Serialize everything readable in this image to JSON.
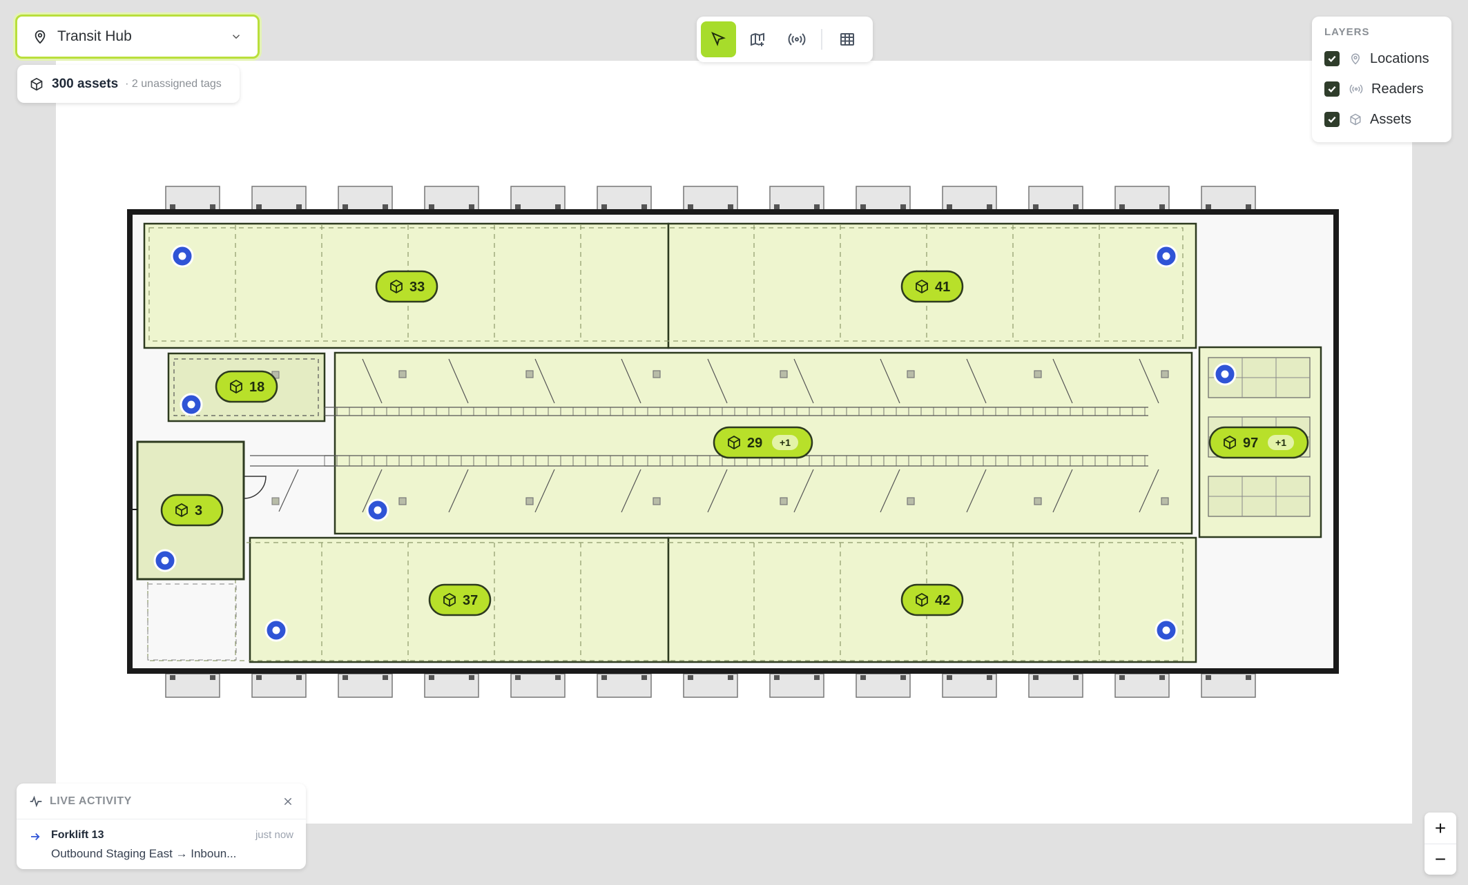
{
  "site_selector": {
    "value": "Transit Hub",
    "icon": "map-pin-icon"
  },
  "asset_summary": {
    "count": "300 assets",
    "unassigned": "· 2 unassigned tags"
  },
  "toolbar": {
    "tools": [
      "select-tool",
      "add-location-tool",
      "reader-tool",
      "grid-view-tool"
    ],
    "active": "select-tool"
  },
  "layers": {
    "title": "LAYERS",
    "items": [
      {
        "label": "Locations",
        "checked": true,
        "icon": "map-pin-icon"
      },
      {
        "label": "Readers",
        "checked": true,
        "icon": "broadcast-icon"
      },
      {
        "label": "Assets",
        "checked": true,
        "icon": "box-icon"
      }
    ]
  },
  "zones": [
    {
      "id": "zone-top-left",
      "count": "33",
      "extra": ""
    },
    {
      "id": "zone-top-right",
      "count": "41",
      "extra": ""
    },
    {
      "id": "zone-office",
      "count": "18",
      "extra": ""
    },
    {
      "id": "zone-middle",
      "count": "29",
      "extra": "+1"
    },
    {
      "id": "zone-east",
      "count": "97",
      "extra": "+1"
    },
    {
      "id": "zone-west",
      "count": "3",
      "extra": ""
    },
    {
      "id": "zone-bottom-left",
      "count": "37",
      "extra": ""
    },
    {
      "id": "zone-bottom-right",
      "count": "42",
      "extra": ""
    }
  ],
  "live_activity": {
    "title": "LIVE ACTIVITY",
    "items": [
      {
        "name": "Forklift 13",
        "route": "Outbound Staging East → Inboun...",
        "time": "just now"
      }
    ]
  },
  "zoom": {
    "in": "+",
    "out": "−"
  },
  "colors": {
    "accent": "#a7dc2b",
    "zone_fill": "#eef5cf",
    "reader": "#2f54d6",
    "wall": "#1a1a1a"
  }
}
